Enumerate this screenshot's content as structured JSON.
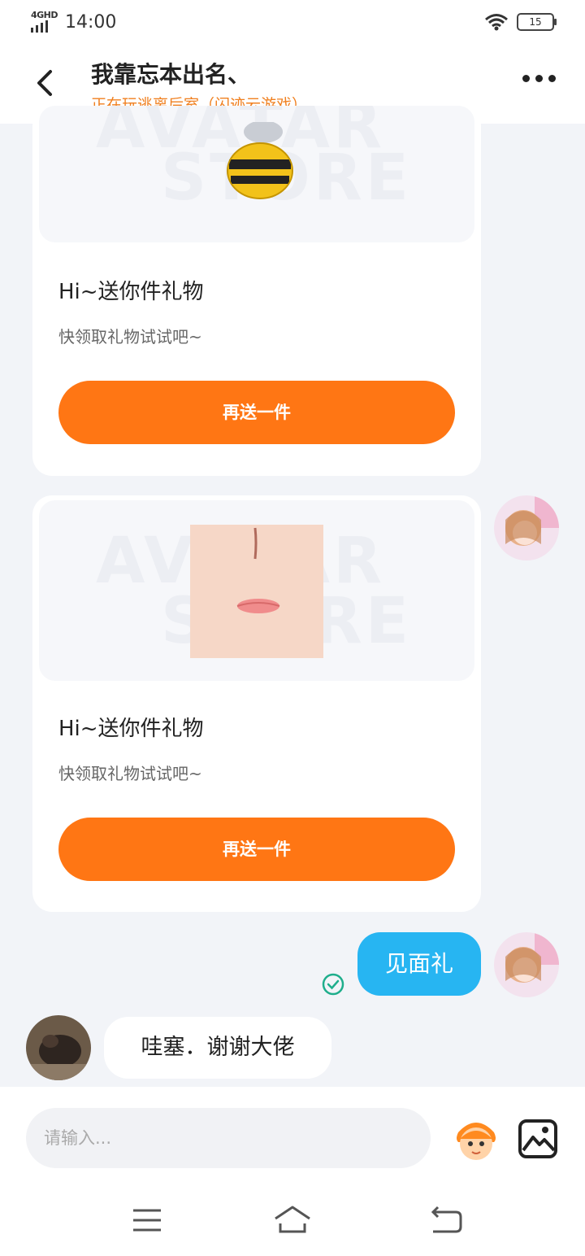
{
  "status_bar": {
    "network_label": "4GHD",
    "time": "14:00",
    "battery": "15"
  },
  "header": {
    "title": "我靠忘本出名、",
    "subtitle": "正在玩逃离后室（闪迹云游戏）"
  },
  "gift_cards": [
    {
      "title": "Hi~送你件礼物",
      "description": "快领取礼物试试吧~",
      "button_label": "再送一件"
    },
    {
      "title": "Hi~送你件礼物",
      "description": "快领取礼物试试吧~",
      "button_label": "再送一件"
    }
  ],
  "watermark": {
    "line1": "AVATAR",
    "line2": "STORE"
  },
  "messages": {
    "sent_text": "见面礼",
    "received_text": "哇塞．谢谢大佬"
  },
  "input": {
    "placeholder": "请输入..."
  },
  "colors": {
    "accent_orange": "#ff7614",
    "subtitle_orange": "#f08020",
    "sent_bubble": "#27b5f2",
    "read_check": "#1fae8c"
  },
  "icons": [
    "back-arrow-icon",
    "more-icon",
    "wifi-icon",
    "battery-icon",
    "emoji-icon",
    "image-icon",
    "menu-icon",
    "home-icon",
    "back-nav-icon",
    "check-icon"
  ]
}
